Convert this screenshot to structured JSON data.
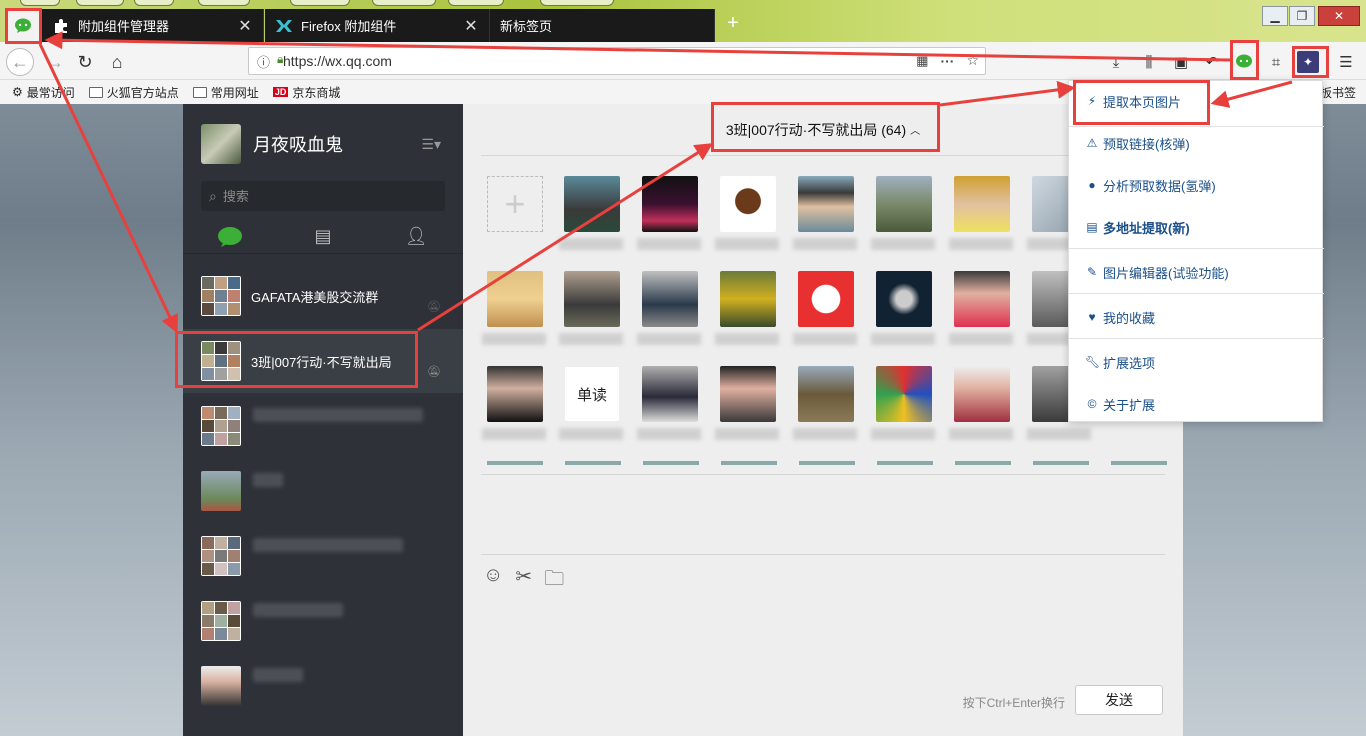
{
  "tabs": [
    {
      "label": "附加组件管理器",
      "icon": "puzzle-icon"
    },
    {
      "label": "Firefox 附加组件",
      "icon": "firefox-addons-icon"
    },
    {
      "label": "新标签页",
      "icon": "none"
    }
  ],
  "nav": {
    "url": "https://wx.qq.com"
  },
  "bookmarks": {
    "items": [
      "最常访问",
      "火狐官方站点",
      "常用网址",
      "京东商城"
    ],
    "jd_badge": "JD",
    "right": "板书签"
  },
  "wechat": {
    "nickname": "月夜吸血鬼",
    "search_placeholder": "搜索",
    "chats": [
      {
        "name": "GAFATA港美股交流群",
        "active": false
      },
      {
        "name": "3班|007行动·不写就出局",
        "active": true
      }
    ],
    "chat_title": "3班|007行动·不写就出局 (64)",
    "member_tile_text": "单读",
    "send_hint": "按下Ctrl+Enter换行",
    "send_label": "发送"
  },
  "dropdown": {
    "items": [
      {
        "label": "提取本页图片",
        "icon": "lightning-icon",
        "bold": false
      },
      {
        "label": "预取链接(核弹)",
        "icon": "warning-icon",
        "bold": false
      },
      {
        "label": "分析预取数据(氢弹)",
        "icon": "bomb-icon",
        "bold": false
      },
      {
        "label": "多地址提取(新)",
        "icon": "list-icon",
        "bold": true
      },
      {
        "label": "图片编辑器(试验功能)",
        "icon": "edit-icon",
        "bold": false
      },
      {
        "label": "我的收藏",
        "icon": "heart-icon",
        "bold": false
      },
      {
        "label": "扩展选项",
        "icon": "wrench-icon",
        "bold": false
      },
      {
        "label": "关于扩展",
        "icon": "copyright-icon",
        "bold": false
      }
    ]
  },
  "colors": {
    "annotation": "#e8403c",
    "wechat_green": "#3caf36",
    "sidebar": "#2e3238",
    "link_blue": "#1a4f8a"
  }
}
